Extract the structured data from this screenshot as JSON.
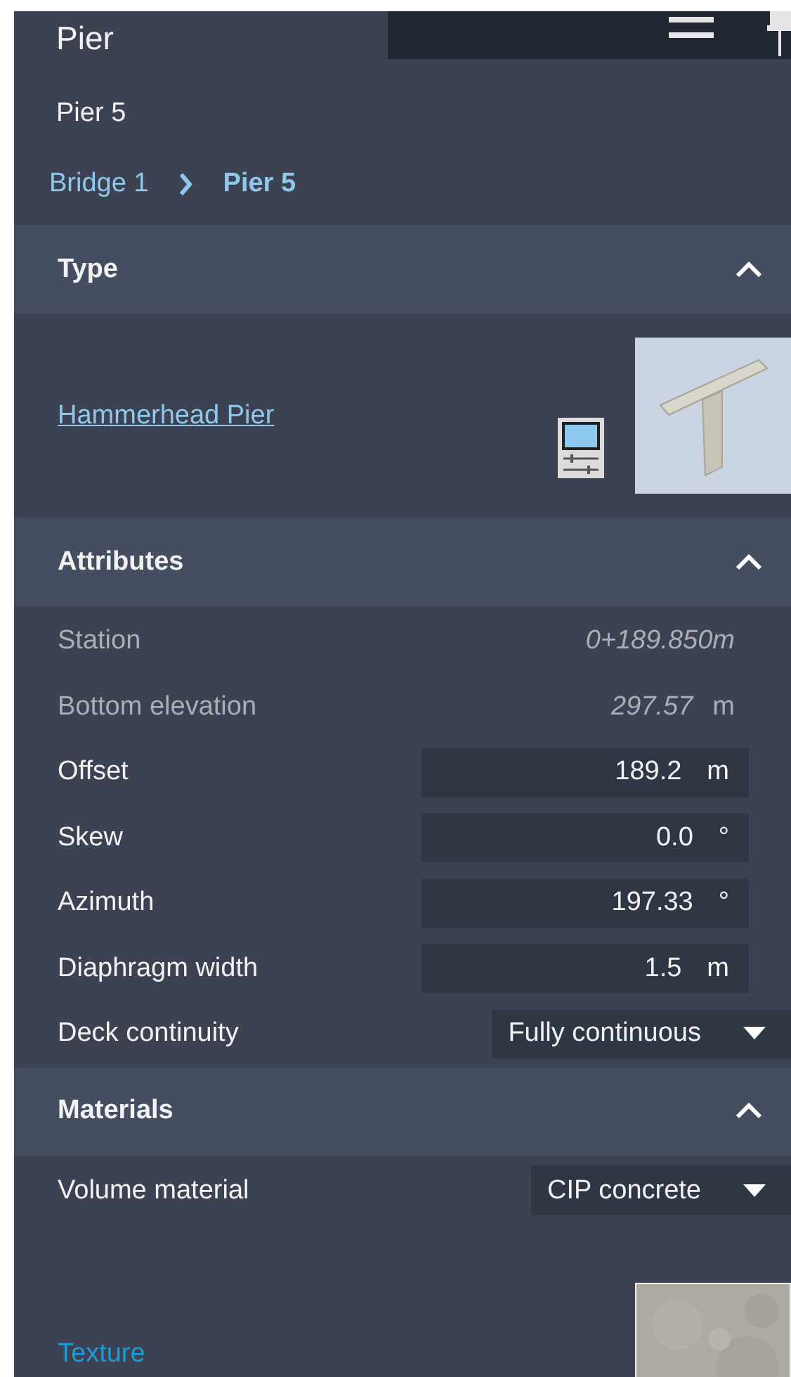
{
  "panel": {
    "title": "Pier",
    "subtitle": "Pier 5"
  },
  "breadcrumb": [
    {
      "label": "Bridge 1",
      "selected": false
    },
    {
      "label": "Pier 5",
      "selected": true
    }
  ],
  "sections": [
    {
      "title": "Type",
      "expanded": true,
      "kind": "type",
      "type_link": "Hammerhead Pier"
    },
    {
      "title": "Attributes",
      "expanded": true,
      "kind": "fields",
      "fields": [
        {
          "kind": "readonly",
          "label": "Station",
          "value": "0+189.850m"
        },
        {
          "kind": "readonly",
          "label": "Bottom elevation",
          "value": "297.57",
          "unit": "m"
        },
        {
          "kind": "input",
          "label": "Offset",
          "value": "189.2",
          "unit": "m"
        },
        {
          "kind": "input",
          "label": "Skew",
          "value": "0.0",
          "unit": "°"
        },
        {
          "kind": "input",
          "label": "Azimuth",
          "value": "197.33",
          "unit": "°"
        },
        {
          "kind": "input",
          "label": "Diaphragm width",
          "value": "1.5",
          "unit": "m"
        },
        {
          "kind": "dropdown",
          "label": "Deck continuity",
          "value": "Fully continuous"
        }
      ]
    },
    {
      "title": "Materials",
      "expanded": true,
      "kind": "fields",
      "fields": [
        {
          "kind": "dropdown",
          "label": "Volume material",
          "value": "CIP concrete"
        },
        {
          "kind": "texture",
          "label": "Texture"
        }
      ]
    }
  ]
}
